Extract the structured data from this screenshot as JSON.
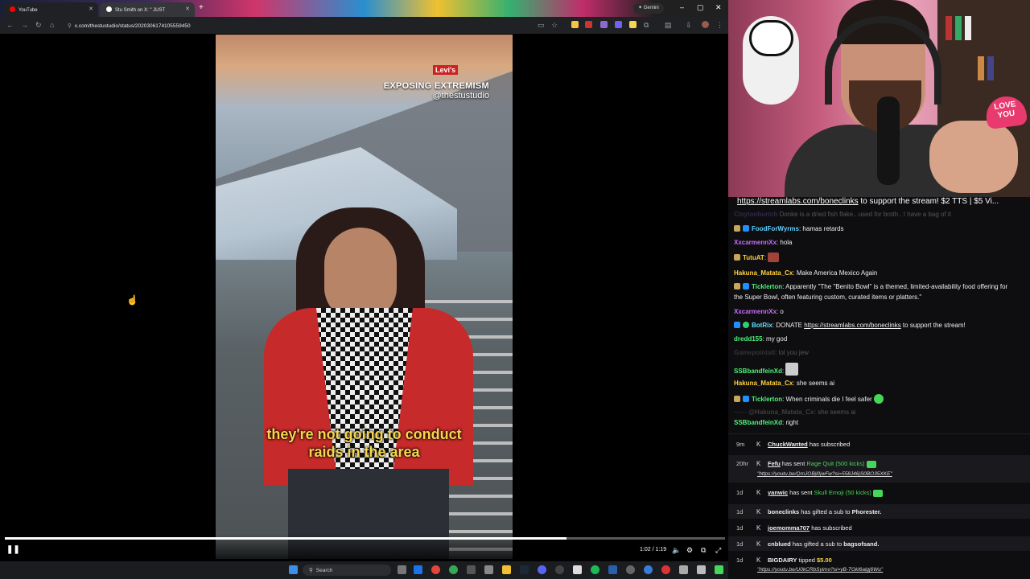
{
  "browser": {
    "tabs": [
      {
        "label": "YouTube"
      },
      {
        "label": "Stu Smith on X: \" JUST"
      }
    ],
    "gemini_label": "Gemini",
    "url": "x.com/thestustudio/status/2020306174105559450"
  },
  "video": {
    "brand": "Levi's",
    "overlay_title": "EXPOSING EXTREMISM",
    "overlay_handle": "@thestustudio",
    "caption_line1": "they're not going to conduct",
    "caption_line2": "raids in the area",
    "timecode": "1:02 / 1:19",
    "progress": 0.78
  },
  "webcam": {
    "sign_text": "LOVE YOU"
  },
  "banner": {
    "link": "https://streamlabs.com/boneclinks",
    "text": " to support the stream! $2 TTS | $5 Vi..."
  },
  "chat": {
    "messages": [
      {
        "user": "Claytonburtch",
        "user_color": "#8a5cd6",
        "text": " Donke is a dried fish flake.. used for broth.. I have a bag of it",
        "faded": true
      },
      {
        "user": "FoodForWyrms",
        "user_color": "#5fd1ff",
        "text": " hamas retards"
      },
      {
        "user": "XxcarmennXx",
        "user_color": "#c86cff",
        "text": " hola"
      },
      {
        "user": "TutuAT",
        "user_color": "#ffcf3d",
        "text": ""
      },
      {
        "user": "Hakuna_Matata_Cx",
        "user_color": "#ffd23f",
        "text": " Make America Mexico Again"
      },
      {
        "user": "Ticklerton",
        "user_color": "#4ef27a",
        "text": " Apparently \"The \"Benito Bowl\" is a themed, limited-availability food offering for the Super Bowl, often featuring custom, curated items or platters.\""
      },
      {
        "user": "XxcarmennXx",
        "user_color": "#c86cff",
        "text": " o"
      },
      {
        "user": "BotRix",
        "user_color": "#5fe0ff",
        "text": " DONATE ",
        "link": "https://streamlabs.com/boneclinks",
        "text_after": " to support the stream!"
      },
      {
        "user": "dredd155",
        "user_color": "#4ef27a",
        "text": " my god"
      },
      {
        "user": "Gamepointatl",
        "user_color": "#888",
        "text": " lol you jew",
        "faded": true
      },
      {
        "user": "SSBbandfeinXd",
        "user_color": "#4ef27a",
        "text": ""
      },
      {
        "user": "Hakuna_Matata_Cx",
        "user_color": "#ffd23f",
        "text": " she seems ai"
      },
      {
        "user": "Ticklerton",
        "user_color": "#4ef27a",
        "text": " When criminals die I feel safer"
      },
      {
        "user": "@Hakuna_Matata_Cx:",
        "user_color": "#888",
        "text": " she seems ai",
        "faded": true
      },
      {
        "user": "SSBbandfeinXd",
        "user_color": "#4ef27a",
        "text": " right"
      }
    ]
  },
  "events": [
    {
      "age": "9m",
      "user": "ChuckWanted",
      "text": " has subscribed"
    },
    {
      "age": "20hr",
      "user": "Fefu",
      "text": " has sent ",
      "item": "Rage Quit (500 kicks)",
      "link": "\"https://youtu.be/QmJOBjl0jwFw?si=558J46jS0BO35XKE\""
    },
    {
      "age": "1d",
      "user": "yanwic",
      "text": " has sent ",
      "item": "Skull Emoji (50 kicks)"
    },
    {
      "age": "1d",
      "user": "boneclinks",
      "text": " has gifted a sub to ",
      "target": "Phorester."
    },
    {
      "age": "1d",
      "user": "joemomma707",
      "text": " has subscribed"
    },
    {
      "age": "1d",
      "user": "cnblued",
      "text": " has gifted a sub to ",
      "target": "bagsofsand."
    },
    {
      "age": "1d",
      "user": "BIGDAIRY",
      "text": " tipped ",
      "amount": "$5.00",
      "link": "\"https://youtu.be/U0kCRbSyimo?si=yB-TGkl6algj6Wu\""
    }
  ],
  "taskbar": {
    "search_placeholder": "Search"
  },
  "colors": {
    "chat_bg": "#0e0e10",
    "kick_green": "#45d75a",
    "caption_yellow": "#f5d64c"
  }
}
